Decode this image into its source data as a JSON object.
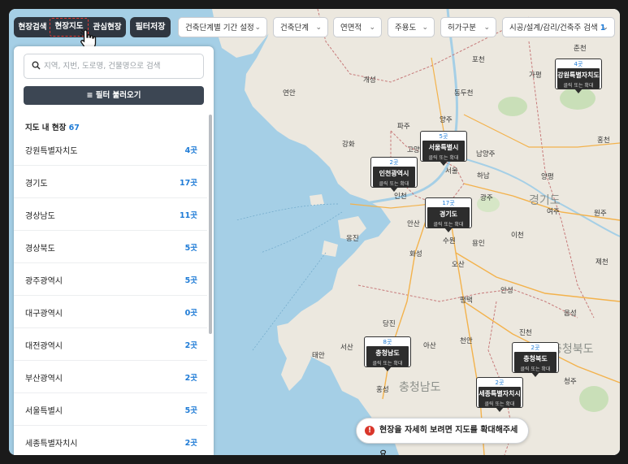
{
  "toolbar": {
    "tab_search": "현장검색",
    "tab_map": "현장지도",
    "tab_interest": "관심현장",
    "filter_save": "필터저장",
    "drop_period": "건축단계별 기간 설정",
    "drop_stage": "건축단계",
    "drop_area": "연면적",
    "drop_use": "주용도",
    "drop_permit": "허가구분",
    "drop_company": "시공/설계/감리/건축주 검색",
    "drop_company_count": "1"
  },
  "panel": {
    "search_placeholder": "지역, 지번, 도로명, 건물명으로 검색",
    "filter_load": "필터 불러오기",
    "list_title": "지도 내 현장",
    "list_count": "67",
    "regions": [
      {
        "name": "강원특별자치도",
        "count": "4곳"
      },
      {
        "name": "경기도",
        "count": "17곳"
      },
      {
        "name": "경상남도",
        "count": "11곳"
      },
      {
        "name": "경상북도",
        "count": "5곳"
      },
      {
        "name": "광주광역시",
        "count": "5곳"
      },
      {
        "name": "대구광역시",
        "count": "0곳"
      },
      {
        "name": "대전광역시",
        "count": "2곳"
      },
      {
        "name": "부산광역시",
        "count": "2곳"
      },
      {
        "name": "서울특별시",
        "count": "5곳"
      },
      {
        "name": "세종특별자치시",
        "count": "2곳"
      }
    ]
  },
  "markers": [
    {
      "count": "4곳",
      "name": "강원특별자치도",
      "sub": "클릭 또는 확대"
    },
    {
      "count": "5곳",
      "name": "서울특별시",
      "sub": "클릭 또는 확대"
    },
    {
      "count": "2곳",
      "name": "인천광역시",
      "sub": "클릭 또는 확대"
    },
    {
      "count": "17곳",
      "name": "경기도",
      "sub": "클릭 또는 확대"
    },
    {
      "count": "8곳",
      "name": "충청남도",
      "sub": "클릭 또는 확대"
    },
    {
      "count": "2곳",
      "name": "충청북도",
      "sub": "클릭 또는 확대"
    },
    {
      "count": "2곳",
      "name": "세종특별자치시",
      "sub": "클릭 또는 확대"
    }
  ],
  "map_labels": {
    "gyeonggi": "경기도",
    "chungnam": "충청남도",
    "chungbuk": "충청북도",
    "seoul": "서울",
    "incheon": "인천",
    "suwon": "수원",
    "hwaseong": "화성",
    "pyeongtaek": "평택",
    "cheonan": "천안",
    "yongin": "용인",
    "icheon": "이천",
    "paju": "파주",
    "goyang": "고양",
    "namyangju": "남양주",
    "hanam": "하남",
    "gwangju": "광주",
    "yeoju": "여주",
    "wonju": "원주",
    "hongcheon": "홍천",
    "chuncheon": "춘천",
    "gapyeong": "가평",
    "pocheon": "포천",
    "yangju": "양주",
    "gimpo": "김포",
    "ansan": "안산",
    "osan": "오산",
    "anseong": "안성",
    "dangjin": "당진",
    "asan": "아산",
    "seosan": "서산",
    "taean": "태안",
    "hongseong": "홍성",
    "jincheon": "진천",
    "eumseong": "음성",
    "cheongju": "청주",
    "gaeseong": "개성",
    "yeonan": "연안",
    "cheorwon": "철원",
    "hwacheon": "화천",
    "dongducheon": "동두천",
    "yangpyeong": "양평",
    "jecheon": "제천",
    "ganghwa": "강화",
    "onggin": "옹진"
  },
  "toast": {
    "message": "현장을 자세히 보려면 지도를 확대해주세요."
  },
  "colors": {
    "sea": "#a5cfe6",
    "land": "#ece8df",
    "accent": "#1e7bd6",
    "dark_button": "#2f3640",
    "highlight_border": "#e53935",
    "warning": "#d9362b"
  }
}
